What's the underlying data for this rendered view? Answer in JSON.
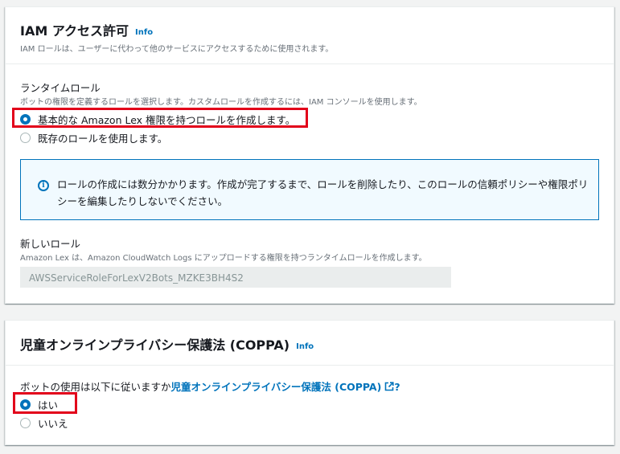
{
  "iam": {
    "title": "IAM アクセス許可",
    "info": "Info",
    "description": "IAM ロールは、ユーザーに代わって他のサービスにアクセスするために使用されます。",
    "runtime_role": {
      "label": "ランタイムロール",
      "description": "ボットの権限を定義するロールを選択します。カスタムロールを作成するには、IAM コンソールを使用します。",
      "options": [
        {
          "label": "基本的な Amazon Lex 権限を持つロールを作成します。",
          "selected": true
        },
        {
          "label": "既存のロールを使用します。",
          "selected": false
        }
      ]
    },
    "alert": {
      "icon": "info-circle-icon",
      "text": "ロールの作成には数分かかります。作成が完了するまで、ロールを削除したり、このロールの信頼ポリシーや権限ポリシーを編集したりしないでください。"
    },
    "new_role": {
      "label": "新しいロール",
      "description": "Amazon Lex は、Amazon CloudWatch Logs にアップロードする権限を持つランタイムロールを作成します。",
      "value": "AWSServiceRoleForLexV2Bots_MZKE3BH4S2"
    }
  },
  "coppa": {
    "title": "児童オンラインプライバシー保護法 (COPPA)",
    "info": "Info",
    "question_prefix": "ボットの使用は以下に従いますか",
    "question_link": "児童オンラインプライバシー保護法 (COPPA)",
    "question_suffix": "?",
    "link_icon": "external-link-icon",
    "options": [
      {
        "label": "はい",
        "selected": true
      },
      {
        "label": "いいえ",
        "selected": false
      }
    ]
  },
  "colors": {
    "accent": "#0073bb",
    "highlight": "#e2001a",
    "alert_bg": "#f1faff"
  }
}
